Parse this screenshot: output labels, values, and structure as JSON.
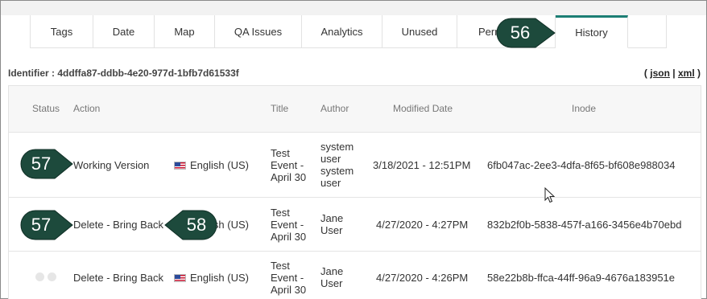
{
  "tabs": [
    {
      "label": "Tags",
      "active": false
    },
    {
      "label": "Date",
      "active": false
    },
    {
      "label": "Map",
      "active": false
    },
    {
      "label": "QA Issues",
      "active": false
    },
    {
      "label": "Analytics",
      "active": false
    },
    {
      "label": "Unused",
      "active": false
    },
    {
      "label": "Perm",
      "active": false
    },
    {
      "label": "History",
      "active": true
    }
  ],
  "identifier": {
    "label": "Identifier : ",
    "value": "4ddffa87-ddbb-4e20-977d-1bfb7d61533f"
  },
  "export": {
    "open": "(",
    "json": "json",
    "sep": "|",
    "xml": "xml",
    "close": ")"
  },
  "table": {
    "headers": {
      "status": "Status",
      "action": "Action",
      "title": "Title",
      "author": "Author",
      "modified": "Modified Date",
      "inode": "Inode"
    },
    "rows": [
      {
        "action": "Working Version",
        "language": "English (US)",
        "title": [
          "Test",
          "Event -",
          "April 30"
        ],
        "author": [
          "system",
          "user",
          "system",
          "user"
        ],
        "modified": "3/18/2021 - 12:51PM",
        "inode": "6fb047ac-2ee3-4dfa-8f65-bf608e988034"
      },
      {
        "action": "Delete - Bring Back",
        "language": "English (US)",
        "title": [
          "Test",
          "Event -",
          "April 30"
        ],
        "author": [
          "Jane",
          "User"
        ],
        "modified": "4/27/2020 - 4:27PM",
        "inode": "832b2f0b-5838-457f-a166-3456e4b70ebd"
      },
      {
        "action": "Delete - Bring Back",
        "language": "English (US)",
        "title": [
          "Test",
          "Event -",
          "April 30"
        ],
        "author": [
          "Jane",
          "User"
        ],
        "modified": "4/27/2020 - 4:26PM",
        "inode": "58e22b8b-ffca-44ff-96a9-4676a183951e"
      }
    ]
  },
  "callouts": {
    "tab_history": "56",
    "row_working": "57",
    "row_delete": "57",
    "bring_back": "58"
  },
  "colors": {
    "accent": "#1c7e74",
    "callout": "#1d4a3c"
  }
}
